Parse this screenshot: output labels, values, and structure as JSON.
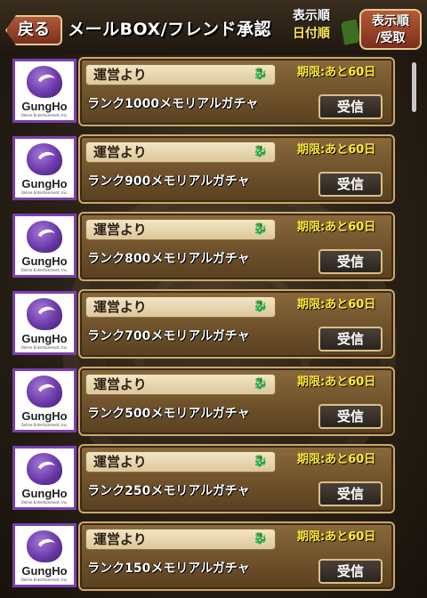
{
  "header": {
    "back_label": "戻る",
    "title": "メールBOX/フレンド承認",
    "sort_order_label": "表示順",
    "sort_order_value": "日付順",
    "sort_button_line1": "表示順",
    "sort_button_line2": "/受取"
  },
  "mails": [
    {
      "sender": "運営より",
      "expiry": "期限:あと60日",
      "subject": "ランク1000メモリアルガチャ",
      "action": "受信",
      "icon_text": "GungHo",
      "icon_sub": "Online Entertainment, Inc."
    },
    {
      "sender": "運営より",
      "expiry": "期限:あと60日",
      "subject": "ランク900メモリアルガチャ",
      "action": "受信",
      "icon_text": "GungHo",
      "icon_sub": "Online Entertainment, Inc."
    },
    {
      "sender": "運営より",
      "expiry": "期限:あと60日",
      "subject": "ランク800メモリアルガチャ",
      "action": "受信",
      "icon_text": "GungHo",
      "icon_sub": "Online Entertainment, Inc."
    },
    {
      "sender": "運営より",
      "expiry": "期限:あと60日",
      "subject": "ランク700メモリアルガチャ",
      "action": "受信",
      "icon_text": "GungHo",
      "icon_sub": "Online Entertainment, Inc."
    },
    {
      "sender": "運営より",
      "expiry": "期限:あと60日",
      "subject": "ランク500メモリアルガチャ",
      "action": "受信",
      "icon_text": "GungHo",
      "icon_sub": "Online Entertainment, Inc."
    },
    {
      "sender": "運営より",
      "expiry": "期限:あと60日",
      "subject": "ランク250メモリアルガチャ",
      "action": "受信",
      "icon_text": "GungHo",
      "icon_sub": "Online Entertainment, Inc."
    },
    {
      "sender": "運営より",
      "expiry": "期限:あと60日",
      "subject": "ランク150メモリアルガチャ",
      "action": "受信",
      "icon_text": "GungHo",
      "icon_sub": "Online Entertainment, Inc."
    }
  ],
  "icons": {
    "sender_badge": "dragon-icon",
    "publisher_logo": "gungho-logo-icon"
  },
  "colors": {
    "expiry_text": "#ffec3a",
    "icon_border": "#7a3fb0",
    "card_border": "#c9a86a"
  }
}
